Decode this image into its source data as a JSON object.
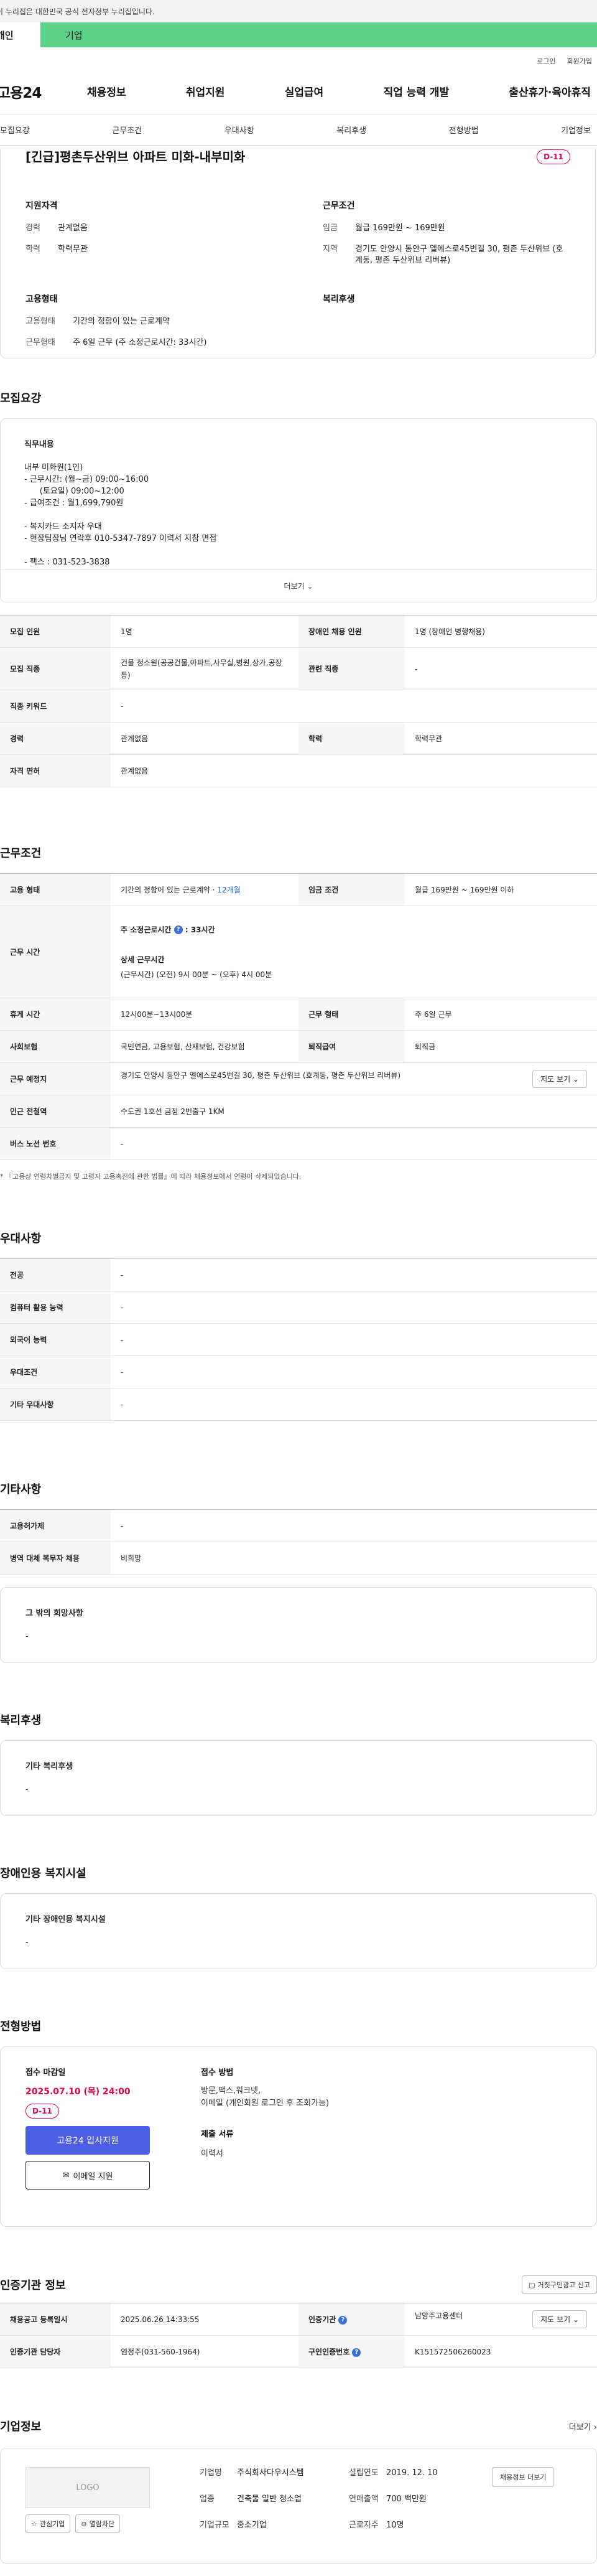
{
  "gov_banner": "이 누리집은 대한민국 공식 전자정부 누리집입니다.",
  "top_tabs": {
    "personal": "개인",
    "company": "기업"
  },
  "util_links": [
    "로그인",
    "회원가입"
  ],
  "logo": "고용24",
  "main_nav": [
    "채용정보",
    "취업지원",
    "실업급여",
    "직업 능력 개발",
    "출산휴가·육아휴직"
  ],
  "anchor_tabs": [
    "모집요강",
    "근무조건",
    "우대사항",
    "복리후생",
    "전형방법",
    "기업정보"
  ],
  "summary": {
    "title": "[긴급]평촌두산위브 아파트 미화-내부미화",
    "dday": "D-11",
    "qual": {
      "heading": "지원자격",
      "rows": [
        {
          "k": "경력",
          "v": "관계없음"
        },
        {
          "k": "학력",
          "v": "학력무관"
        }
      ]
    },
    "cond": {
      "heading": "근무조건",
      "rows": [
        {
          "k": "임금",
          "v": "월급 169만원 ~ 169만원"
        },
        {
          "k": "지역",
          "v": "경기도 안양시 동안구 엘에스로45번길 30, 평촌 두산위브 (호계동, 평촌 두산위브 리버뷰)"
        }
      ]
    },
    "emp": {
      "heading": "고용형태",
      "rows": [
        {
          "k": "고용형태",
          "v": "기간의 정함이 있는 근로계약"
        },
        {
          "k": "근무형태",
          "v": "주 6일 근무 (주 소정근로시간: 33시간)"
        }
      ]
    },
    "welfare_heading": "복리후생"
  },
  "recruit": {
    "section_title": "모집요강",
    "desc_heading": "직무내용",
    "desc_lines": [
      "내부 미화원(1인)",
      "- 근무시간: (월~금) 09:00~16:00",
      "      (토요일) 09:00~12:00",
      "- 급여조건 : 월1,699,790원",
      "",
      "- 복지카드 소지자 우대",
      "- 현장팀장님 연락후 010-5347-7897 이력서 지참 면접",
      "",
      "- 팩스 : 031-523-3838"
    ],
    "more": "더보기",
    "table": [
      {
        "k1": "모집 인원",
        "v1": "1명",
        "k2": "장애인 채용 인원",
        "v2": "1명 (장애인 병행채용)"
      },
      {
        "k1": "모집 직종",
        "v1": "건물 청소원(공공건물,아파트,사무실,병원,상가,공장 등)",
        "k2": "관련 직종",
        "v2": "-"
      },
      {
        "k1": "직종 키워드",
        "v1": "-"
      },
      {
        "k1": "경력",
        "v1": "관계없음",
        "k2": "학력",
        "v2": "학력무관"
      },
      {
        "k1": "자격 면허",
        "v1": "관계없음"
      }
    ]
  },
  "work": {
    "section_title": "근무조건",
    "emp_type_k": "고용 형태",
    "emp_type_v": "기간의 정함이 있는 근로계약 · ",
    "emp_type_months": "12개월",
    "wage_k": "임금 조건",
    "wage_v": "월급 169만원 ~ 169만원 이하",
    "hours_k": "근무 시간",
    "hours_weekly_label": "주 소정근로시간",
    "hours_weekly_q": "?",
    "hours_weekly_value": ": 33시간",
    "hours_detail_label": "상세 근무시간",
    "hours_detail_value": "(근무시간) (오전) 9시 00분 ~ (오후) 4시 00분",
    "rows": [
      {
        "k1": "휴게 시간",
        "v1": "12시00분~13시00분",
        "k2": "근무 형태",
        "v2": "주 6일 근무"
      },
      {
        "k1": "사회보험",
        "v1": "국민연금, 고용보험, 산재보험, 건강보험",
        "k2": "퇴직급여",
        "v2": "퇴직금"
      }
    ],
    "addr_k": "근무 예정지",
    "addr_v": "경기도 안양시 동안구 엘에스로45번길 30, 평촌 두산위브 (호계동, 평촌 두산위브 리버뷰)",
    "map_btn": "지도 보기",
    "subway_k": "인근 전철역",
    "subway_v": "수도권 1호선 금정 2번출구 1KM",
    "bus_k": "버스 노선 번호",
    "bus_v": "-",
    "note": "* 『고용상 연령차별금지 및 고령자 고용촉진에 관한 법률』에 따라 채용정보에서 연령이 삭제되었습니다."
  },
  "pref": {
    "section_title": "우대사항",
    "rows": [
      {
        "k": "전공",
        "v": "-"
      },
      {
        "k": "컴퓨터 활용 능력",
        "v": "-"
      },
      {
        "k": "외국어 능력",
        "v": "-"
      },
      {
        "k": "우대조건",
        "v": "-"
      },
      {
        "k": "기타 우대사항",
        "v": "-"
      }
    ]
  },
  "etc": {
    "section_title": "기타사항",
    "rows": [
      {
        "k": "고용허가제",
        "v": "-"
      },
      {
        "k": "병역 대체 복무자 채용",
        "v": "비희망"
      }
    ],
    "other_heading": "그 밖의 희망사항",
    "other_value": "-"
  },
  "benefit": {
    "section_title": "복리후생",
    "heading": "기타 복리후생",
    "value": "-"
  },
  "facility": {
    "section_title": "장애인용 복지시설",
    "heading": "기타 장애인용 복지시설",
    "value": "-"
  },
  "selection": {
    "section_title": "전형방법",
    "deadline_label": "접수 마감일",
    "deadline": "2025.07.10 (목) 24:00",
    "dday": "D-11",
    "apply_btn": "고용24 입사지원",
    "email_btn": "이메일 지원",
    "method_label": "접수 방법",
    "method_value_1": "방문,팩스,워크넷,",
    "method_value_2": "이메일 (개인회원 로그인 후 조회가능)",
    "docs_label": "제출 서류",
    "docs_value": "이력서"
  },
  "cert": {
    "section_title": "인증기관 정보",
    "report_btn": "거짓구인광고 신고",
    "rows": [
      {
        "k1": "채용공고 등록일시",
        "v1": "2025.06.26 14:33:55",
        "k2": "인증기관",
        "v2": "남양주고용센터"
      },
      {
        "k1": "인증기관 담당자",
        "v1": "염정주(031-560-1964)",
        "k2": "구인인증번호",
        "v2": "K151572506260023"
      }
    ],
    "map_btn": "지도 보기"
  },
  "company": {
    "section_title": "기업정보",
    "more": "더보기",
    "logo_text": "LOGO",
    "fav_btn": "관심기업",
    "block_btn": "열람차단",
    "rows_left": [
      {
        "k": "기업명",
        "v": "주식회사다우시스템"
      },
      {
        "k": "업종",
        "v": "건축물 일반 청소업"
      },
      {
        "k": "기업규모",
        "v": "중소기업"
      }
    ],
    "rows_right": [
      {
        "k": "설립연도",
        "v": "2019. 12. 10"
      },
      {
        "k": "연매출액",
        "v": "700 백만원"
      },
      {
        "k": "근로자수",
        "v": "10명"
      }
    ],
    "detail_btn": "채용정보 더보기"
  }
}
